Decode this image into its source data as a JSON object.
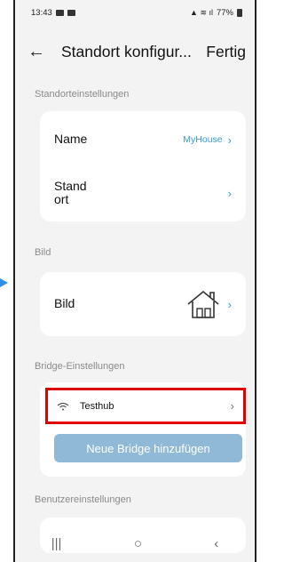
{
  "status": {
    "time": "13:43",
    "battery": "77%"
  },
  "header": {
    "title": "Standort konfigur...",
    "done_label": "Fertig"
  },
  "sections": {
    "location": "Standorteinstellungen",
    "image": "Bild",
    "bridge": "Bridge-Einstellungen",
    "user": "Benutzereinstellungen"
  },
  "location": {
    "name_label": "Name",
    "name_value": "MyHouse",
    "place_label_line1": "Stand",
    "place_label_line2": "ort"
  },
  "image": {
    "label": "Bild"
  },
  "bridge": {
    "hub_name": "Testhub",
    "add_label": "Neue Bridge hinzufügen"
  },
  "colors": {
    "accent": "#3a9ad9",
    "highlight": "#e00000",
    "button_disabled": "#8fb9d6"
  }
}
